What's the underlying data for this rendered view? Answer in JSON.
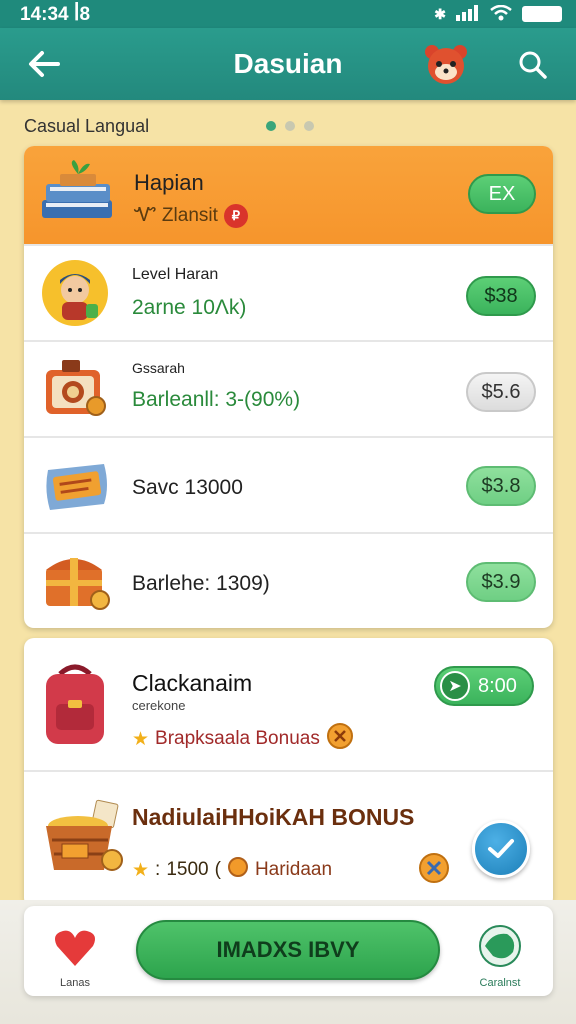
{
  "status_bar": {
    "time": "14:34",
    "time_suffix": "ꟾ8"
  },
  "app_bar": {
    "title": "Dasuian"
  },
  "section": {
    "label": "Casual Langual"
  },
  "card_header": {
    "title": "Hapian",
    "subtitle": "Ꮙ Zlansit",
    "badge": "EX"
  },
  "rows": [
    {
      "label": "Level Haran",
      "value": "2arne 10Λk)",
      "price": "$38"
    },
    {
      "label": "Gssarah",
      "value": "Barleanll: 3-(90%)",
      "price": "$5.6"
    },
    {
      "label": "",
      "value": "Savc 13000",
      "price": "$3.8"
    },
    {
      "label": "",
      "value": "Barlehe: 1309)",
      "price": "$3.9"
    }
  ],
  "card2": {
    "title": "Clackanaim",
    "small": "cerekone",
    "bonus_line": "Brapksaala Bonuas",
    "timer": "8:00",
    "bonus_title": "NadiulaiHHoiKAH BONUS",
    "bonus_amount": "1500",
    "bonus_extra": "Haridaan"
  },
  "cta": {
    "label": "IMADXS IBVY"
  },
  "bottom_nav": {
    "left_label": "Lanas",
    "right_label": "Caralnst"
  },
  "colors": {
    "teal": "#23897d",
    "orange": "#f6952c",
    "green": "#3bb35c",
    "cream": "#f6e3a6"
  }
}
